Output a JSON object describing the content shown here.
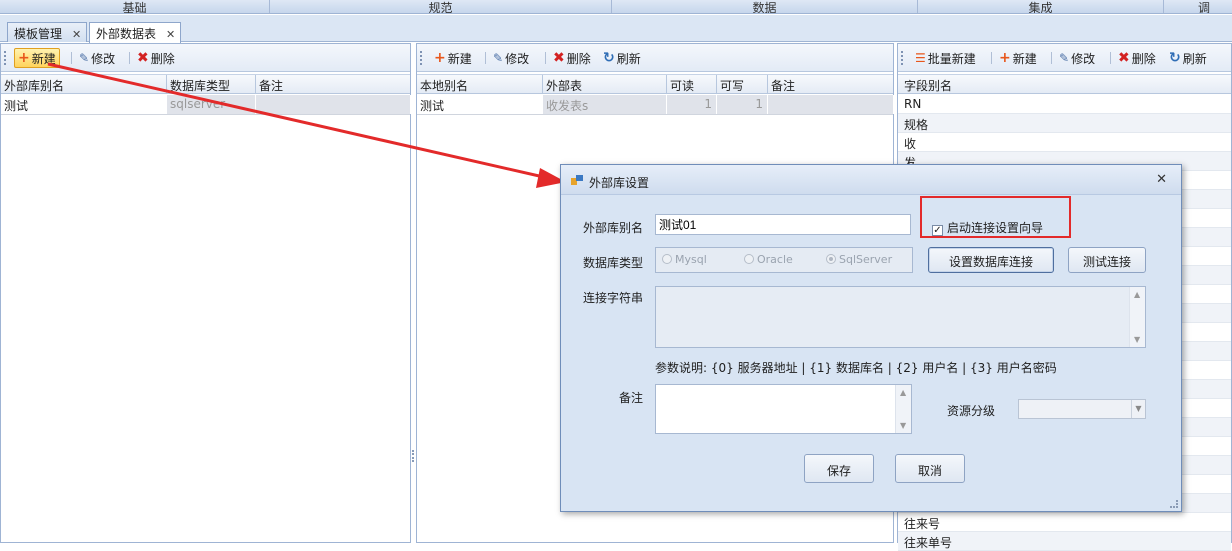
{
  "topnav": [
    "基础",
    "规范",
    "数据",
    "集成",
    "调"
  ],
  "tabs": [
    {
      "label": "模板管理",
      "close": "✕"
    },
    {
      "label": "外部数据表",
      "close": "✕"
    }
  ],
  "left_panel": {
    "toolbar": {
      "new": "新建",
      "edit": "修改",
      "delete": "删除"
    },
    "columns": [
      "外部库别名",
      "数据库类型",
      "备注"
    ],
    "rows": [
      {
        "alias": "测试",
        "db_type": "sqlserver",
        "note": ""
      }
    ]
  },
  "middle_panel": {
    "toolbar": {
      "new": "新建",
      "edit": "修改",
      "delete": "删除",
      "refresh": "刷新"
    },
    "columns": [
      "本地别名",
      "外部表",
      "可读",
      "可写",
      "备注"
    ],
    "rows": [
      {
        "alias": "测试",
        "table": "收发表s",
        "read": "1",
        "write": "1",
        "note": ""
      }
    ]
  },
  "right_panel": {
    "toolbar": {
      "batch_new": "批量新建",
      "new": "新建",
      "edit": "修改",
      "delete": "删除",
      "refresh": "刷新"
    },
    "column": "字段别名",
    "fields_top": [
      "RN",
      "规格",
      "收",
      "发"
    ],
    "fields_bottom": [
      "往来号",
      "往来单号"
    ]
  },
  "dialog": {
    "title": "外部库设置",
    "close": "✕",
    "alias_label": "外部库别名",
    "alias_value": "测试01",
    "wizard_label": "启动连接设置向导",
    "wizard_checked": "✓",
    "dbtype_label": "数据库类型",
    "db_options": [
      "Mysql",
      "Oracle",
      "SqlServer"
    ],
    "db_selected": "SqlServer",
    "setup_button": "设置数据库连接",
    "test_button": "测试连接",
    "conn_label": "连接字符串",
    "conn_value": "",
    "param_hint": "参数说明: {0} 服务器地址 | {1} 数据库名 | {2} 用户名 | {3} 用户名密码",
    "note_label": "备注",
    "note_value": "",
    "level_label": "资源分级",
    "level_value": "",
    "save_button": "保存",
    "cancel_button": "取消"
  },
  "colors": {
    "annotation_red": "#e32a2a",
    "accent_orange": "#e8571c",
    "title_blue": "#cfdcee"
  }
}
